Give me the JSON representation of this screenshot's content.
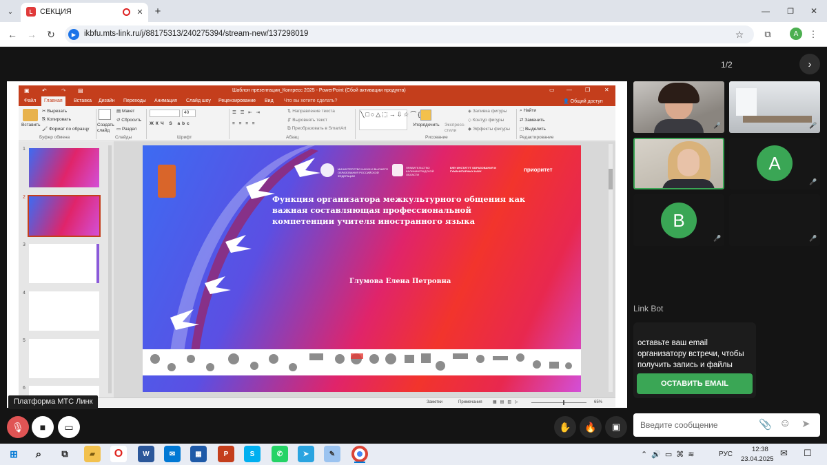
{
  "browser": {
    "tab_title": "СЕКЦИЯ",
    "url": "ikbfu.mts-link.ru/j/88175313/240275394/stream-new/137298019",
    "profile_letter": "A"
  },
  "meeting": {
    "page_indicator": "1/2",
    "platform_label": "Платформа МТС Линк",
    "chat_sender": "Link Bot",
    "chat_message": "оставьте ваш email организатору встречи, чтобы получить запись и файлы",
    "email_button": "ОСТАВИТЬ EMAIL",
    "message_placeholder": "Введите сообщение",
    "participants": [
      {
        "type": "video",
        "tone": "woman-1"
      },
      {
        "type": "video",
        "tone": "room"
      },
      {
        "type": "video",
        "tone": "woman-2",
        "active": true
      },
      {
        "type": "avatar",
        "letter": "A"
      },
      {
        "type": "avatar",
        "letter": "B"
      },
      {
        "type": "empty"
      }
    ]
  },
  "ppt": {
    "window_title": "Шаблон презентации_Конгресс 2025 - PowerPoint (Сбой активации продукта)",
    "share": "Общий доступ",
    "tabs": [
      "Файл",
      "Главная",
      "Вставка",
      "Дизайн",
      "Переходы",
      "Анимация",
      "Слайд шоу",
      "Рецензирование",
      "Вид",
      "Что вы хотите сделать?"
    ],
    "ribbon": {
      "cut": "Вырезать",
      "copy": "Копировать",
      "format_painter": "Формат по образцу",
      "paste": "Вставить",
      "clipboard": "Буфер обмена",
      "new_slide": "Создать слайд",
      "layout": "Макет",
      "reset": "Сбросить",
      "section": "Раздел",
      "slides": "Слайды",
      "font_size": "40",
      "font": "Шрифт",
      "text_dir": "Направление текста",
      "align_text": "Выровнять текст",
      "smartart": "Преобразовать в SmartArt",
      "paragraph": "Абзац",
      "arrange": "Упорядочить",
      "quick_styles": "Экспресс-стили",
      "fill": "Заливка фигуры",
      "outline": "Контур фигуры",
      "effects": "Эффекты фигуры",
      "drawing": "Рисование",
      "find": "Найти",
      "replace": "Заменить",
      "select": "Выделить",
      "editing": "Редактирование"
    },
    "thumb_numbers": [
      "1",
      "2",
      "3",
      "4",
      "5",
      "6"
    ],
    "status_notes": "Заметки",
    "status_comments": "Примечания",
    "zoom": "65%"
  },
  "slide": {
    "title": "Функция организатора межкультурного общения как важная составляющая профессиональной компетенции учителя иностранного языка",
    "author": "Глумова Елена Петровна",
    "header_logos": [
      "МИНИСТЕРСТВО НАУКИ И ВЫСШЕГО ОБРАЗОВАНИЯ РОССИЙСКОЙ ФЕДЕРАЦИИ",
      "ПРАВИТЕЛЬСТВО КАЛИНИНГРАДСКОЙ ОБЛАСТИ",
      "БФУ ИНСТИТУТ ОБРАЗОВАНИЯ И ГУМАНИТАРНЫХ НАУК",
      "приоритет"
    ]
  },
  "taskbar": {
    "lang": "РУС",
    "time": "12:38",
    "date": "23.04.2025"
  },
  "colors": {
    "ppt_red": "#c43e1c",
    "email_green": "#3aa655",
    "avatar_green": "#3aa655",
    "mic_off_red": "#e04646"
  }
}
